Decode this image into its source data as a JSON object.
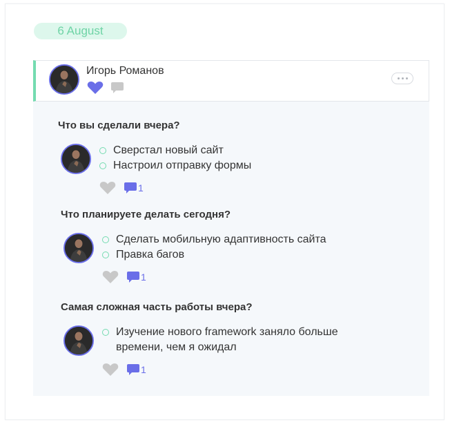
{
  "date": "6 August",
  "author": {
    "name": "Игорь Романов",
    "avatar_icon": "avatar-photo"
  },
  "colors": {
    "accent_green": "#74dbb0",
    "accent_purple": "#6a6ee8",
    "icon_gray": "#c8c8c8",
    "panel_bg": "#f5f8fb"
  },
  "sections": [
    {
      "question": "Что вы сделали вчера?",
      "answers": [
        "Сверстал новый сайт",
        "Настроил отправку формы"
      ],
      "comment_count": "1"
    },
    {
      "question": "Что планируете делать сегодня?",
      "answers": [
        "Сделать мобильную адаптивность сайта",
        "Правка багов"
      ],
      "comment_count": "1"
    },
    {
      "question": "Самая сложная часть работы вчера?",
      "answers": [
        "Изучение нового framework заняло больше времени, чем я ожидал"
      ],
      "comment_count": "1"
    }
  ]
}
